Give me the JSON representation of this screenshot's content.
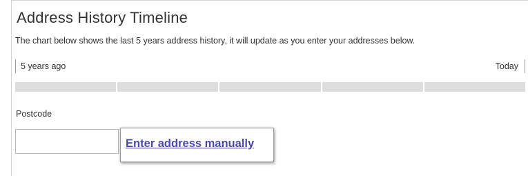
{
  "section": {
    "title": "Address History Timeline",
    "description": "The chart below shows the last 5 years address history, it will update as you enter your addresses below."
  },
  "timeline": {
    "start_label": "5 years ago",
    "end_label": "Today",
    "segment_count": 5,
    "segment_color": "#dddddd"
  },
  "postcode": {
    "label": "Postcode",
    "value": ""
  },
  "manual_entry": {
    "link_label": "Enter address manually",
    "link_color": "#4a4aa6"
  }
}
